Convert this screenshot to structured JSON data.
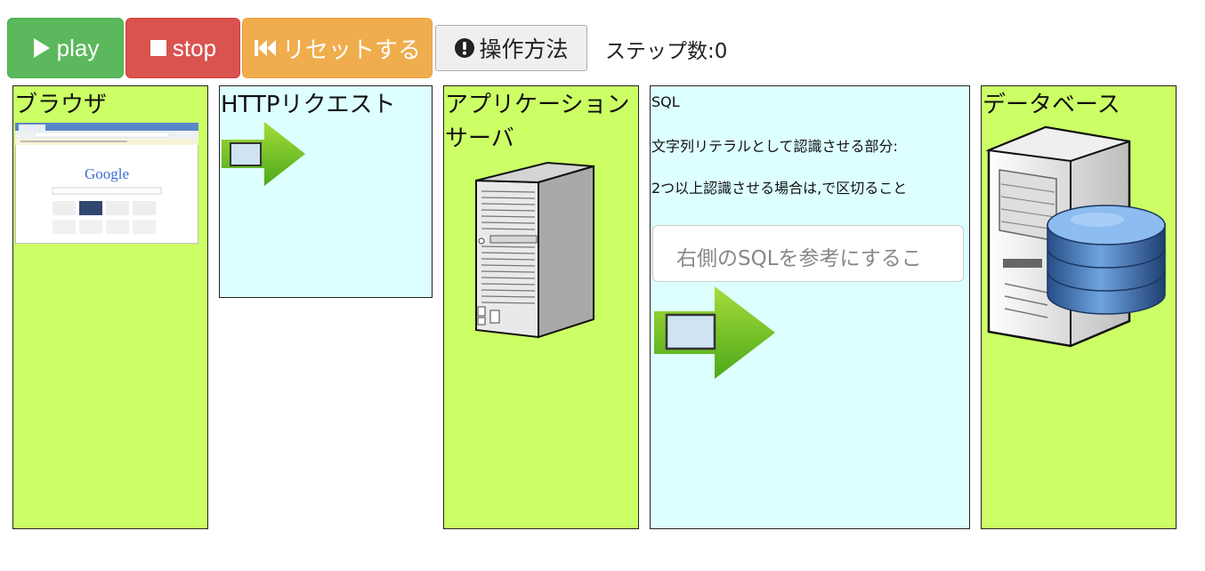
{
  "toolbar": {
    "play_label": "play",
    "stop_label": "stop",
    "reset_label": "リセットする",
    "help_label": "操作方法",
    "step_label": "ステップ数",
    "step_separator": ":",
    "step_count": "0"
  },
  "panels": {
    "browser": {
      "title": "ブラウザ",
      "logo_text": "Google"
    },
    "http": {
      "title": "HTTPリクエスト"
    },
    "appserver": {
      "title_line1": "アプリケーション",
      "title_line2": "サーバ"
    },
    "sql": {
      "heading": "SQL",
      "line1": "文字列リテラルとして認識させる部分:",
      "line2": "2つ以上認識させる場合は,で区切ること",
      "input_placeholder": "右側のSQLを参考にするこ"
    },
    "database": {
      "title": "データベース"
    }
  },
  "colors": {
    "play": "#5cb85c",
    "stop": "#d9534f",
    "reset": "#f0ad4e",
    "panel_green": "#ccff66",
    "panel_cyan": "#ddffff"
  },
  "icons": [
    "play-icon",
    "stop-icon",
    "fast-backward-icon",
    "exclamation-circle-icon",
    "request-arrow-icon",
    "server-tower-icon",
    "database-server-icon",
    "browser-screenshot"
  ]
}
